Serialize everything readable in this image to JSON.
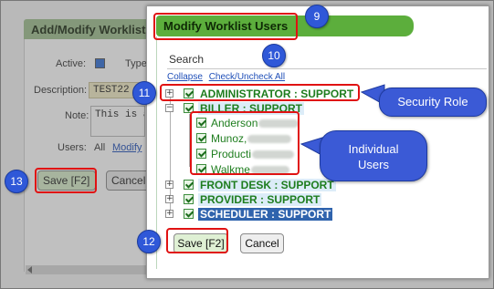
{
  "background_form": {
    "title": "Add/Modify Worklist",
    "active_label": "Active:",
    "type_label": "Type",
    "description_label": "Description:",
    "description_value": "TEST22",
    "note_label": "Note:",
    "note_value": "This is a",
    "users_label": "Users:",
    "users_all": "All",
    "users_modify_link": "Modify",
    "save_label": "Save [F2]",
    "cancel_label": "Cancel"
  },
  "modal": {
    "title": "Modify Worklist Users",
    "search_placeholder": "Search",
    "links": {
      "collapse": "Collapse",
      "check_uncheck_all": "Check/Uncheck All"
    },
    "tree": [
      {
        "label": "ADMINISTRATOR : SUPPORT",
        "expanded": false,
        "checked": true
      },
      {
        "label": "BILLER : SUPPORT",
        "expanded": true,
        "checked": true,
        "children": [
          {
            "label": "Anderson",
            "checked": true
          },
          {
            "label": "Munoz,",
            "checked": true
          },
          {
            "label": "Producti",
            "checked": true
          },
          {
            "label": "Walkme",
            "checked": true
          }
        ]
      },
      {
        "label": "FRONT DESK : SUPPORT",
        "expanded": false,
        "checked": true
      },
      {
        "label": "PROVIDER : SUPPORT",
        "expanded": false,
        "checked": true
      },
      {
        "label": "SCHEDULER : SUPPORT",
        "expanded": false,
        "checked": true,
        "selected": true
      }
    ],
    "save_label": "Save [F2]",
    "cancel_label": "Cancel"
  },
  "annotations": {
    "badges": [
      "9",
      "10",
      "11",
      "12",
      "13"
    ],
    "callouts": {
      "security_role": "Security Role",
      "individual_users": "Individual Users"
    },
    "colors": {
      "callout_blue": "#3b5ad6",
      "highlight_red": "#e01212",
      "header_green": "#5cae3c"
    }
  }
}
